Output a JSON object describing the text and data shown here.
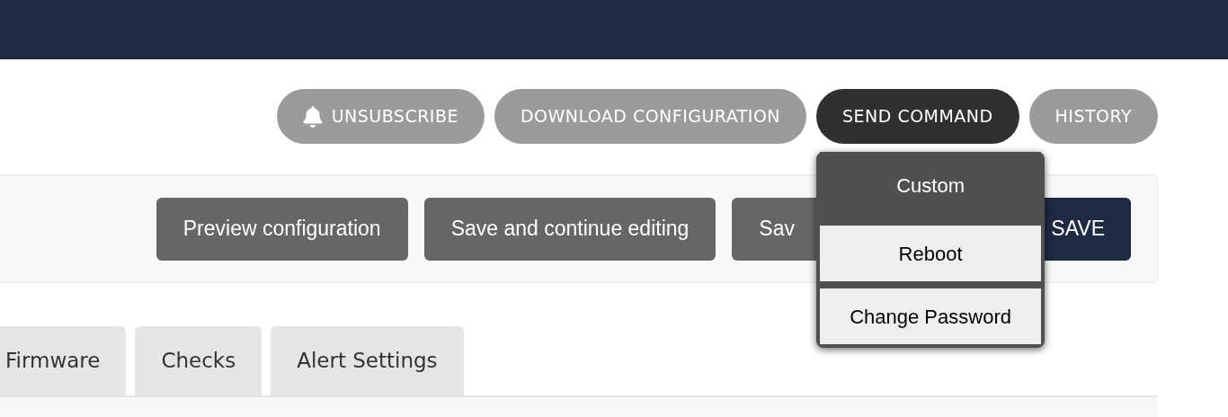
{
  "actions": [
    {
      "label": "UNSUBSCRIBE",
      "kind": "bell",
      "selected": false
    },
    {
      "label": "DOWNLOAD CONFIGURATION",
      "kind": "plain",
      "selected": false
    },
    {
      "label": "SEND COMMAND",
      "kind": "plain",
      "selected": true
    },
    {
      "label": "HISTORY",
      "kind": "plain",
      "selected": false
    }
  ],
  "command_menu": [
    {
      "label": "Custom",
      "selected": true
    },
    {
      "label": "Reboot",
      "selected": false
    },
    {
      "label": "Change Password",
      "selected": false
    }
  ],
  "submit_row": [
    {
      "label": "Preview configuration",
      "kind": "secondary"
    },
    {
      "label": "Save and continue editing",
      "kind": "secondary"
    },
    {
      "label": "Sav",
      "kind": "secondary"
    },
    {
      "label": "SAVE",
      "kind": "primary"
    }
  ],
  "tabs": [
    {
      "label": "Firmware",
      "selected": false
    },
    {
      "label": "Checks",
      "selected": false
    },
    {
      "label": "Alert Settings",
      "selected": false
    }
  ]
}
